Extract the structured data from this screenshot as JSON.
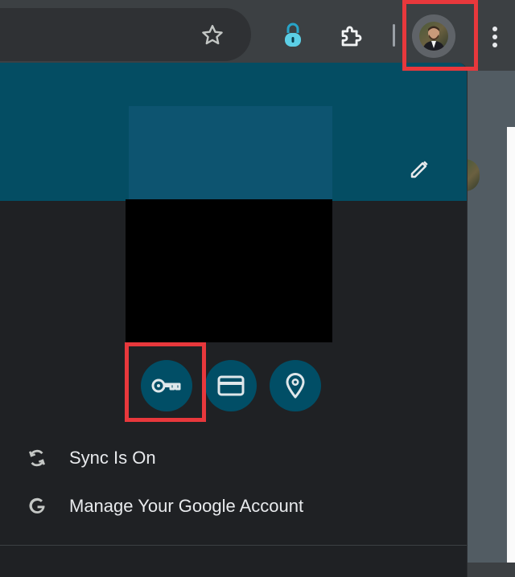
{
  "toolbar": {
    "icons": {
      "star": "star-icon",
      "extension_lock": "lock-icon",
      "extensions": "puzzle-icon",
      "profile": "avatar",
      "more": "more-vertical-icon"
    }
  },
  "profile_menu": {
    "edit_icon": "pencil-icon",
    "quick_actions": [
      {
        "name": "passwords",
        "icon": "key-icon"
      },
      {
        "name": "payment-methods",
        "icon": "credit-card-icon"
      },
      {
        "name": "addresses",
        "icon": "location-pin-icon"
      }
    ],
    "items": [
      {
        "label": "Sync Is On",
        "icon": "sync-icon"
      },
      {
        "label": "Manage Your Google Account",
        "icon": "google-g-icon"
      }
    ]
  },
  "colors": {
    "banner": "#044d63",
    "panel_bg": "#1f2124",
    "quick_button": "#014e66",
    "highlight": "#e8383c",
    "toolbar_bg": "#3c4043"
  }
}
